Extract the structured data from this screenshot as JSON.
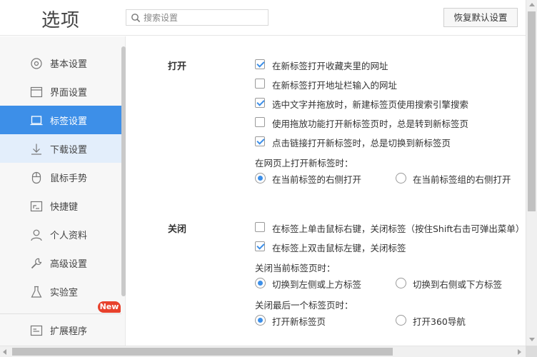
{
  "header": {
    "title": "选项",
    "search_placeholder": "搜索设置",
    "reset_label": "恢复默认设置"
  },
  "sidebar": {
    "items": [
      {
        "label": "基本设置",
        "icon": "gear-circle-icon"
      },
      {
        "label": "界面设置",
        "icon": "window-icon"
      },
      {
        "label": "标签设置",
        "icon": "tab-icon",
        "state": "active"
      },
      {
        "label": "下载设置",
        "icon": "download-icon",
        "state": "hover"
      },
      {
        "label": "鼠标手势",
        "icon": "mouse-icon"
      },
      {
        "label": "快捷键",
        "icon": "shortcut-icon"
      },
      {
        "label": "个人资料",
        "icon": "person-icon"
      },
      {
        "label": "高级设置",
        "icon": "wrench-icon"
      },
      {
        "label": "实验室",
        "icon": "flask-icon"
      },
      {
        "label": "扩展程序",
        "icon": "extension-icon"
      }
    ],
    "new_badge": "New"
  },
  "open_section": {
    "title": "打开",
    "options": [
      {
        "label": "在新标签打开收藏夹里的网址",
        "checked": true
      },
      {
        "label": "在新标签打开地址栏输入的网址",
        "checked": false
      },
      {
        "label": "选中文字并拖放时，新建标签页使用搜索引擎搜索",
        "checked": true
      },
      {
        "label": "使用拖放功能打开新标签页时，总是转到新标签页",
        "checked": false
      },
      {
        "label": "点击链接打开新标签时，总是切换到新标签页",
        "checked": true
      }
    ],
    "sub_label": "在网页上打开新标签时：",
    "radios": [
      {
        "label": "在当前标签的右侧打开",
        "checked": true
      },
      {
        "label": "在当前标签组的右侧打开",
        "checked": false
      }
    ]
  },
  "close_section": {
    "title": "关闭",
    "options": [
      {
        "label": "在标签上单击鼠标右键，关闭标签（按住Shift右击可弹出菜单）",
        "checked": false
      },
      {
        "label": "在标签上双击鼠标左键，关闭标签",
        "checked": true
      }
    ],
    "sub_label_1": "关闭当前标签页时：",
    "radios_1": [
      {
        "label": "切换到左侧或上方标签",
        "checked": true
      },
      {
        "label": "切换到右侧或下方标签",
        "checked": false
      }
    ],
    "sub_label_2": "关闭最后一个标签页时：",
    "radios_2": [
      {
        "label": "打开新标签页",
        "checked": true
      },
      {
        "label": "打开360导航",
        "checked": false
      }
    ]
  },
  "colors": {
    "accent": "#3d8fe8",
    "badge": "#e8412c",
    "sidebar_bg": "#f7f7f7"
  }
}
